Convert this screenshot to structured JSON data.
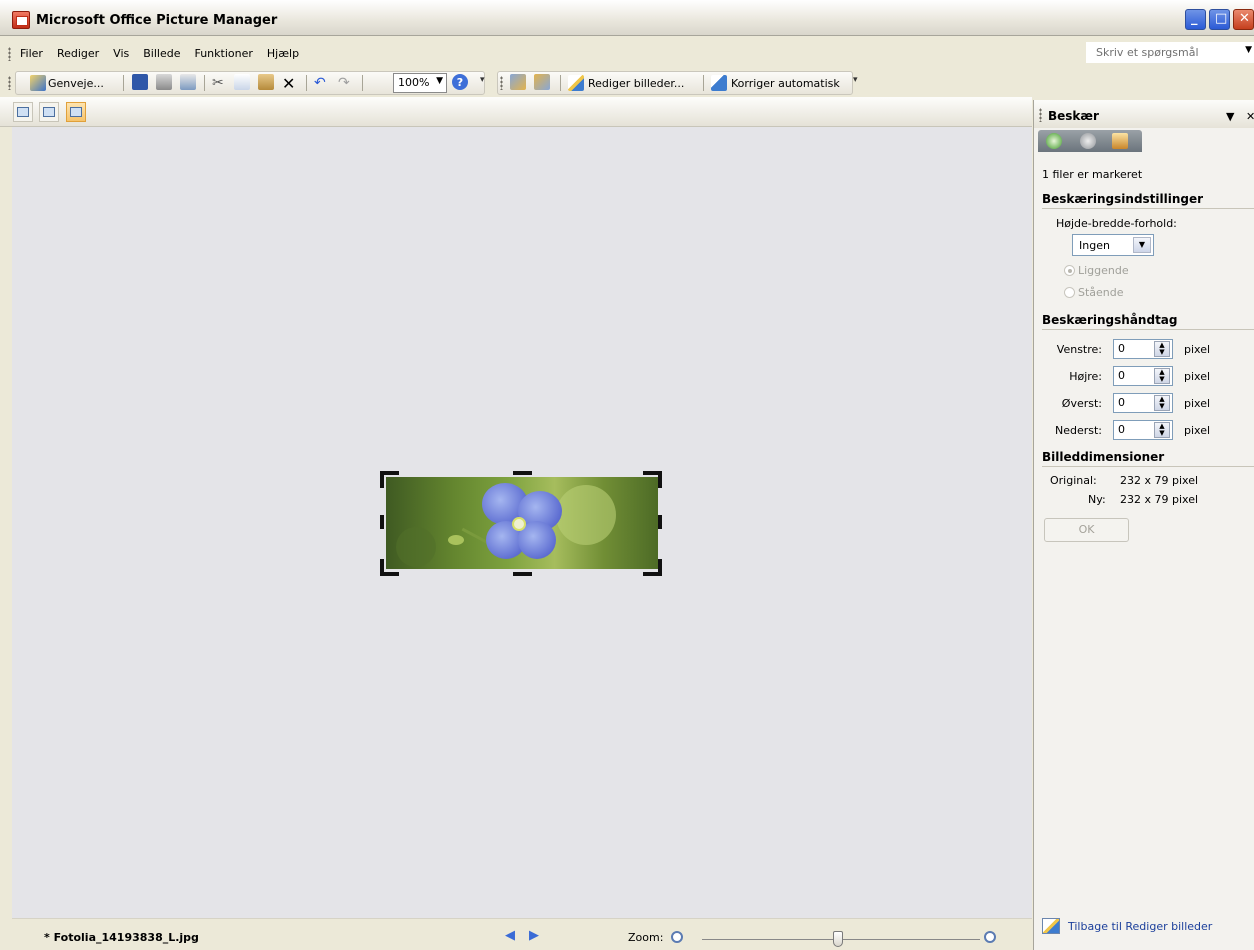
{
  "window": {
    "title": "Microsoft Office Picture Manager"
  },
  "menu": {
    "items": [
      "Filer",
      "Rediger",
      "Vis",
      "Billede",
      "Funktioner",
      "Hjælp"
    ]
  },
  "ask": {
    "placeholder": "Skriv et spørgsmål"
  },
  "toolbar": {
    "shortcuts_label": "Genveje...",
    "zoom_value": "100%",
    "edit_pictures_label": "Rediger billeder...",
    "auto_correct_label": "Korriger automatisk"
  },
  "status": {
    "filename": "* Fotolia_14193838_L.jpg",
    "zoom_label": "Zoom:",
    "zoom_level": 0.5
  },
  "panel": {
    "title": "Beskær",
    "selected_info": "1 filer er markeret",
    "crop_settings_heading": "Beskæringsindstillinger",
    "aspect_label": "Højde-bredde-forhold:",
    "aspect_value": "Ingen",
    "landscape_label": "Liggende",
    "portrait_label": "Stående",
    "handles_heading": "Beskæringshåndtag",
    "handles": [
      {
        "label": "Venstre:",
        "value": "0",
        "unit": "pixel"
      },
      {
        "label": "Højre:",
        "value": "0",
        "unit": "pixel"
      },
      {
        "label": "Øverst:",
        "value": "0",
        "unit": "pixel"
      },
      {
        "label": "Nederst:",
        "value": "0",
        "unit": "pixel"
      }
    ],
    "dimensions_heading": "Billeddimensioner",
    "original_label": "Original:",
    "original_value": "232 x 79 pixel",
    "new_label": "Ny:",
    "new_value": "232 x 79 pixel",
    "ok_label": "OK",
    "back_link": "Tilbage til Rediger billeder"
  },
  "colors": {
    "accent": "#2b5ad6",
    "close": "#c53f1e",
    "canvas": "#e4e4e8",
    "link": "#1b3f9b"
  }
}
